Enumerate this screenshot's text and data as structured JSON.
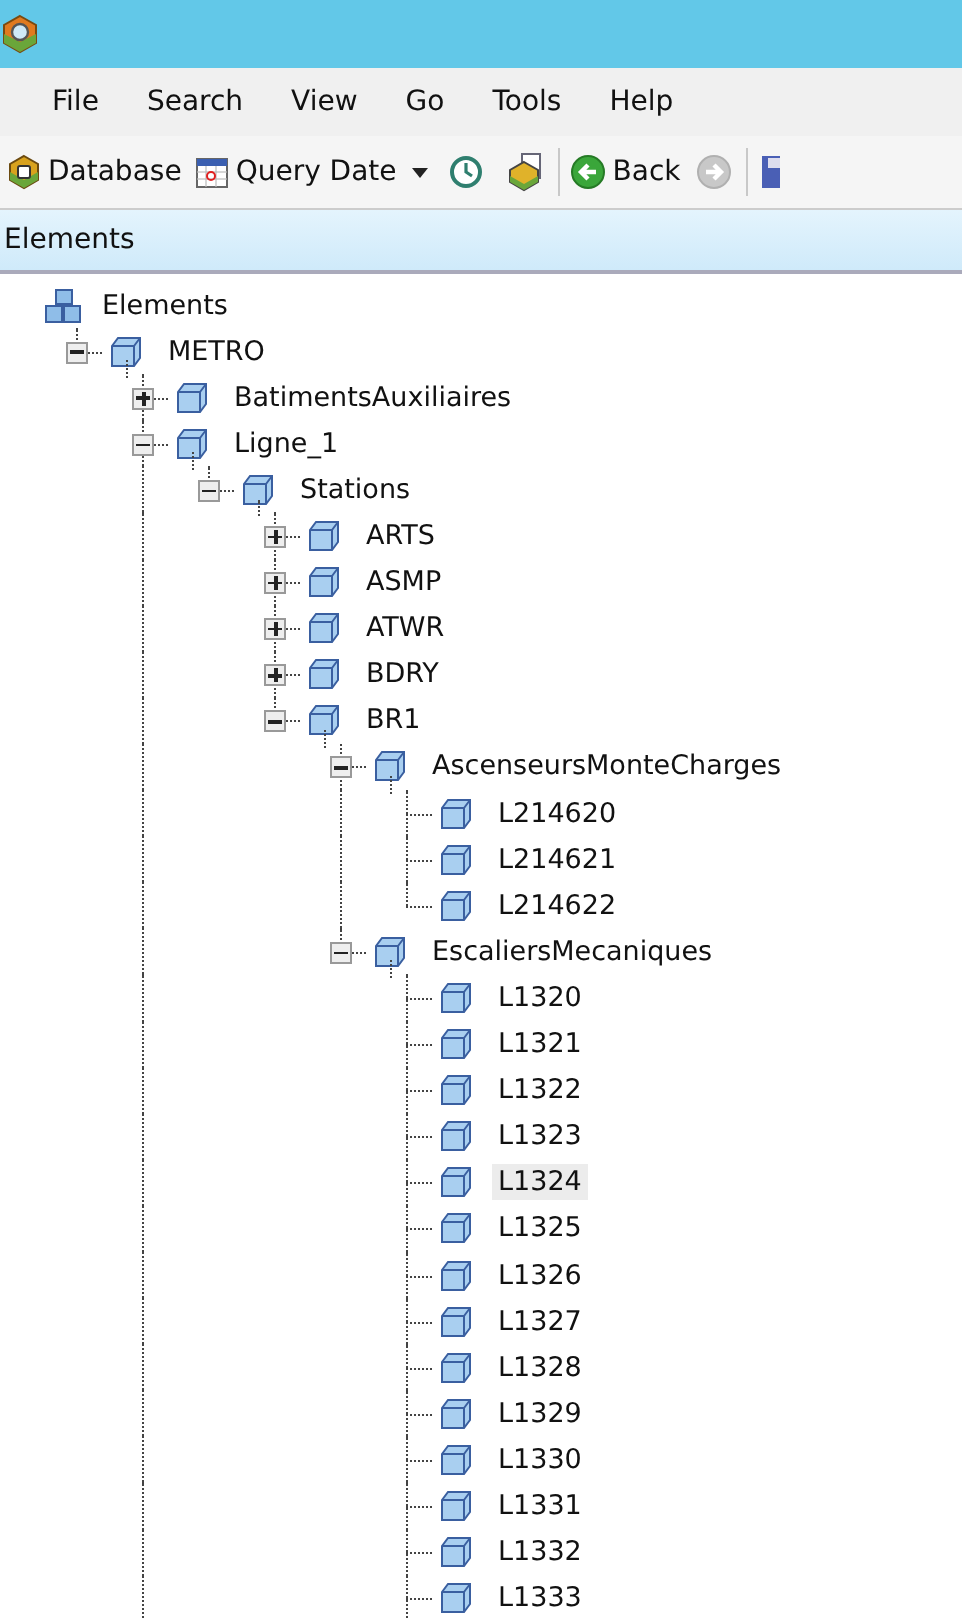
{
  "menu": [
    "File",
    "Search",
    "View",
    "Go",
    "Tools",
    "Help"
  ],
  "toolbar": [
    {
      "kind": "database",
      "label": "Database"
    },
    {
      "kind": "query_date",
      "label": "Query Date"
    },
    {
      "kind": "dropdown"
    },
    {
      "kind": "clock"
    },
    {
      "kind": "layers"
    },
    {
      "kind": "separator"
    },
    {
      "kind": "back",
      "label": "Back"
    },
    {
      "kind": "forward",
      "disabled": true
    },
    {
      "kind": "separator"
    },
    {
      "kind": "save"
    }
  ],
  "panel": {
    "title": "Elements"
  },
  "tree": [
    {
      "label": "Elements",
      "selected": false,
      "children": [
        {
          "label": "METRO",
          "selected": false,
          "expanded": true,
          "children": [
            {
              "label": "BatimentsAuxiliaires",
              "selected": false,
              "expanded": false
            },
            {
              "label": "Ligne_1",
              "selected": false,
              "expanded": true,
              "has_next_sibling": true,
              "children": [
                {
                  "label": "Stations",
                  "selected": false,
                  "expanded": true,
                  "children": [
                    {
                      "label": "ARTS",
                      "selected": false,
                      "expanded": false
                    },
                    {
                      "label": "ASMP",
                      "selected": false,
                      "expanded": false
                    },
                    {
                      "label": "ATWR",
                      "selected": false,
                      "expanded": false
                    },
                    {
                      "label": "BDRY",
                      "selected": false,
                      "expanded": false
                    },
                    {
                      "label": "BR1",
                      "selected": false,
                      "expanded": true,
                      "children": [
                        {
                          "label": "AscenseursMonteCharges",
                          "selected": false,
                          "expanded": true,
                          "children": [
                            {
                              "label": "L214620",
                              "selected": false
                            },
                            {
                              "label": "L214621",
                              "selected": false
                            },
                            {
                              "label": "L214622",
                              "selected": false
                            }
                          ]
                        },
                        {
                          "label": "EscaliersMecaniques",
                          "selected": false,
                          "expanded": true,
                          "children": [
                            {
                              "label": "L1320",
                              "selected": false
                            },
                            {
                              "label": "L1321",
                              "selected": false
                            },
                            {
                              "label": "L1322",
                              "selected": false
                            },
                            {
                              "label": "L1323",
                              "selected": false
                            },
                            {
                              "label": "L1324",
                              "selected": true
                            },
                            {
                              "label": "L1325",
                              "selected": false
                            },
                            {
                              "label": "L1326",
                              "selected": false
                            },
                            {
                              "label": "L1327",
                              "selected": false
                            },
                            {
                              "label": "L1328",
                              "selected": false
                            },
                            {
                              "label": "L1329",
                              "selected": false
                            },
                            {
                              "label": "L1330",
                              "selected": false
                            },
                            {
                              "label": "L1331",
                              "selected": false
                            },
                            {
                              "label": "L1332",
                              "selected": false
                            },
                            {
                              "label": "L1333",
                              "selected": false,
                              "has_next_sibling": true
                            }
                          ]
                        }
                      ]
                    }
                  ]
                }
              ]
            }
          ]
        }
      ]
    }
  ]
}
